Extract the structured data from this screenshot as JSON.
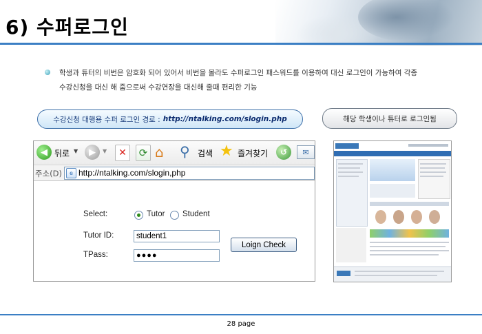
{
  "slide": {
    "title": "6) 수퍼로그인",
    "description_lines": [
      "학생과 튜터의 비번은 암호화 되어 있어서 비번을 몰라도 수퍼로그인 패스워드를 이용하여 대신 로그인이 가능하여 각종",
      "수강신청을 대신 해 줌으로써 수강연장을 대신해 줄때 편리한 기능"
    ],
    "route_label": "수강신청 대행용 수퍼 로그인 경로 :",
    "route_url": "http://ntalking.com/slogin.php",
    "login_note": "해당 학생이나 튜터로 로그인됨",
    "page_number": "28 page"
  },
  "browser": {
    "toolbar": {
      "back_label": "뒤로",
      "search_label": "검색",
      "favorites_label": "즐겨찾기"
    },
    "address_label": "주소(D)",
    "address_url": "http://ntalking.com/slogin,php"
  },
  "login_form": {
    "select_label": "Select:",
    "options": [
      "Tutor",
      "Student"
    ],
    "selected": "Tutor",
    "tutor_id_label": "Tutor ID:",
    "tutor_id_value": "student1",
    "tpass_label": "TPass:",
    "tpass_value": "●●●●",
    "button_label": "Loign Check"
  },
  "colors": {
    "accent": "#3b7fc4",
    "route_text": "#1a3d7c"
  }
}
